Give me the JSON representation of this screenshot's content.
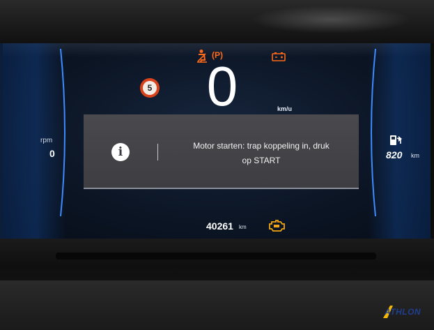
{
  "cluster": {
    "rpm": {
      "label": "rpm",
      "value": "0"
    },
    "range": {
      "value": "820",
      "unit": "km"
    },
    "speed": {
      "value": "0",
      "unit": "km/u"
    },
    "speed_limit": "5",
    "odometer": {
      "value": "40261",
      "unit": "km"
    },
    "indicators": {
      "parking": "(P)",
      "seatbelt_icon": "seatbelt-warning-icon",
      "battery_icon": "battery-warning-icon",
      "engine_icon": "engine-check-icon",
      "fuel_icon": "fuel-pump-icon"
    },
    "message": {
      "icon": "info-icon",
      "line1": "Motor starten: trap koppeling in, druk",
      "line2": "op START"
    }
  },
  "watermark": "ATHLON",
  "colors": {
    "warning_orange": "#ff6a1a",
    "engine_yellow": "#f2a511",
    "accent_blue": "#2f7dff",
    "message_bg": "#444448"
  }
}
